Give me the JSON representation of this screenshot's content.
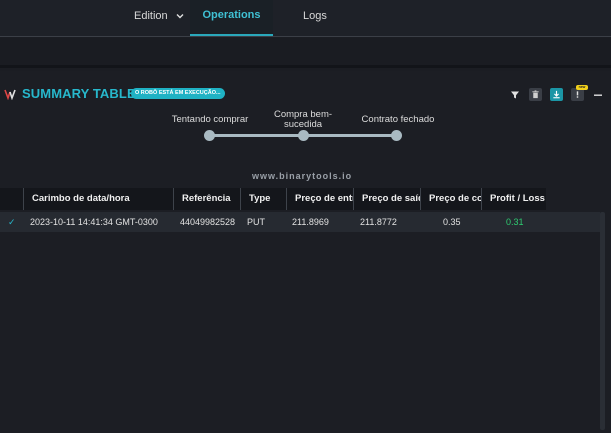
{
  "nav": {
    "edition": "Edition",
    "operations": "Operations",
    "logs": "Logs"
  },
  "summary": {
    "title": "SUMMARY TABLE",
    "status_badge": "O ROBÔ ESTÁ EM EXECUÇÃO...",
    "new_badge": "new",
    "accent_color": "#27b8cc"
  },
  "steps": [
    {
      "label": "Tentando comprar"
    },
    {
      "label": "Compra bem-sucedida"
    },
    {
      "label": "Contrato fechado"
    }
  ],
  "watermark": "www.binarytools.io",
  "table": {
    "columns": [
      "Carimbo de data/hora",
      "Referência",
      "Type",
      "Preço de entrada",
      "Preço de saída",
      "Preço de compra",
      "Profit / Loss"
    ],
    "rows": [
      {
        "status": "✓",
        "timestamp": "2023-10-11 14:41:34 GMT-0300",
        "reference": "44049982528",
        "type": "PUT",
        "entry_price": "211.8969",
        "exit_price": "211.8772",
        "buy_price": "0.35",
        "profit_loss": "0.31"
      }
    ]
  }
}
